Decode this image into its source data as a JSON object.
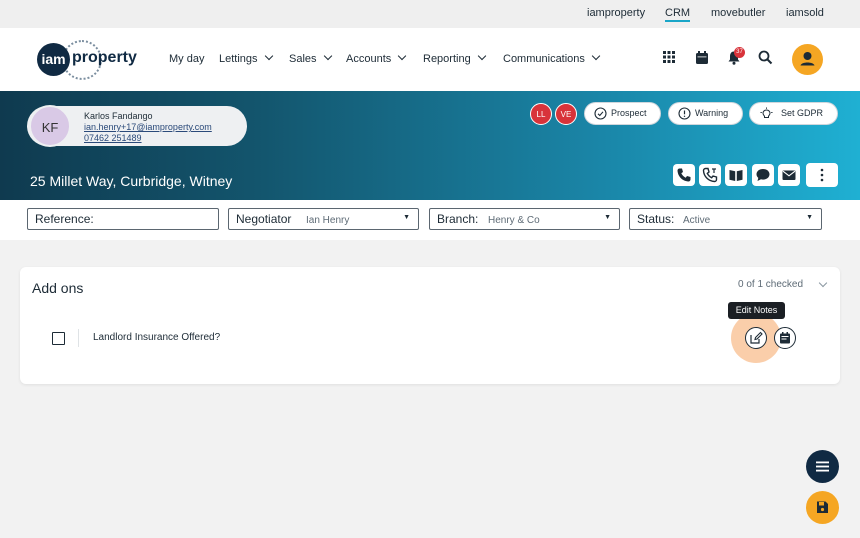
{
  "top_links": [
    "iamproperty",
    "CRM",
    "movebutler",
    "iamsold"
  ],
  "logo": {
    "mark": "iam",
    "word": "property"
  },
  "nav": {
    "items": [
      "My day",
      "Lettings",
      "Sales",
      "Accounts",
      "Reporting",
      "Communications"
    ],
    "notification_count": "37"
  },
  "contact": {
    "initials": "KF",
    "name": "Karlos Fandango",
    "email": "ian.henry+17@iamproperty.com",
    "phone": "07462 251489"
  },
  "tags": [
    "LL",
    "VE"
  ],
  "status_pills": [
    "Prospect",
    "Warning",
    "Set GDPR"
  ],
  "address": "25 Millet Way, Curbridge, Witney",
  "filters": {
    "reference_label": "Reference:",
    "negotiator_label": "Negotiator",
    "negotiator_value": "Ian Henry",
    "branch_label": "Branch:",
    "branch_value": "Henry & Co",
    "status_label": "Status:",
    "status_value": "Active"
  },
  "addons": {
    "title": "Add ons",
    "checked_summary": "0 of 1 checked",
    "items": [
      {
        "label": "Landlord Insurance Offered?",
        "checked": false
      }
    ],
    "tooltip": "Edit Notes"
  },
  "colors": {
    "accent": "#f5a623",
    "navy": "#102a43",
    "tag_red": "#d8333a",
    "banner_cyan": "#1fb0d3"
  },
  "icons": [
    "apps-grid-icon",
    "calendar-icon",
    "bell-icon",
    "search-icon",
    "user-icon",
    "phone-icon",
    "call-log-icon",
    "open-book-icon",
    "chat-icon",
    "mail-icon",
    "more-vertical-icon",
    "edit-icon",
    "note-icon",
    "menu-icon",
    "save-icon"
  ]
}
